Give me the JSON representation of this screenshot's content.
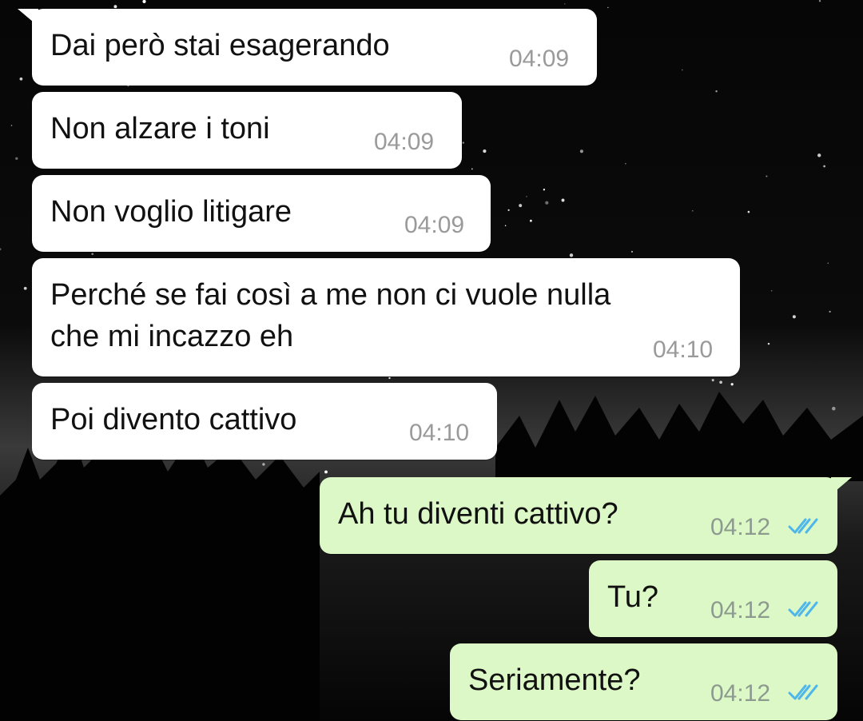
{
  "chat": {
    "messages": [
      {
        "direction": "incoming",
        "text": "Dai però stai esagerando",
        "time": "04:09"
      },
      {
        "direction": "incoming",
        "text": "Non alzare i toni",
        "time": "04:09"
      },
      {
        "direction": "incoming",
        "text": "Non voglio litigare",
        "time": "04:09"
      },
      {
        "direction": "incoming",
        "text_line1": "Perché se fai così a me non ci vuole nulla",
        "text_line2": "che mi incazzo eh",
        "time": "04:10"
      },
      {
        "direction": "incoming",
        "text": "Poi divento cattivo",
        "time": "04:10"
      },
      {
        "direction": "outgoing",
        "text": "Ah tu diventi cattivo?",
        "time": "04:12",
        "status": "read"
      },
      {
        "direction": "outgoing",
        "text": "Tu?",
        "time": "04:12",
        "status": "read"
      },
      {
        "direction": "outgoing",
        "text": "Seriamente?",
        "time": "04:12",
        "status": "read"
      }
    ]
  },
  "colors": {
    "incoming_bubble": "#ffffff",
    "outgoing_bubble": "#dcf8c6",
    "read_ticks": "#4fb6ec",
    "wallpaper": "#050505"
  },
  "icons": {
    "read_receipt": "double-check-icon"
  }
}
